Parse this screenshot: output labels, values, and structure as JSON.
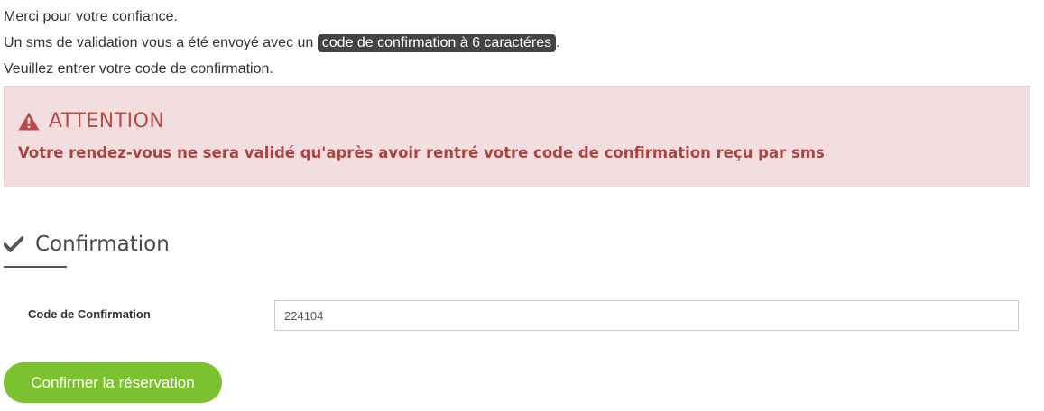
{
  "intro": {
    "line1": "Merci pour votre confiance.",
    "line2_prefix": "Un sms de validation vous a été envoyé avec un ",
    "line2_highlight": "code de confirmation à 6 caractéres",
    "line2_suffix": ".",
    "line3": "Veuillez entrer votre code de confirmation."
  },
  "alert": {
    "icon": "warning-triangle-icon",
    "title": "ATTENTION",
    "message": "Votre rendez-vous ne sera validé qu'après avoir rentré votre code de confirmation reçu par sms",
    "background_color": "#f2dede",
    "text_color": "#a94442"
  },
  "section": {
    "icon": "checkmark-icon",
    "title": "Confirmation"
  },
  "form": {
    "code_label": "Code de Confirmation",
    "code_value": "224104"
  },
  "submit": {
    "label": "Confirmer la réservation",
    "color": "#7cc130"
  }
}
